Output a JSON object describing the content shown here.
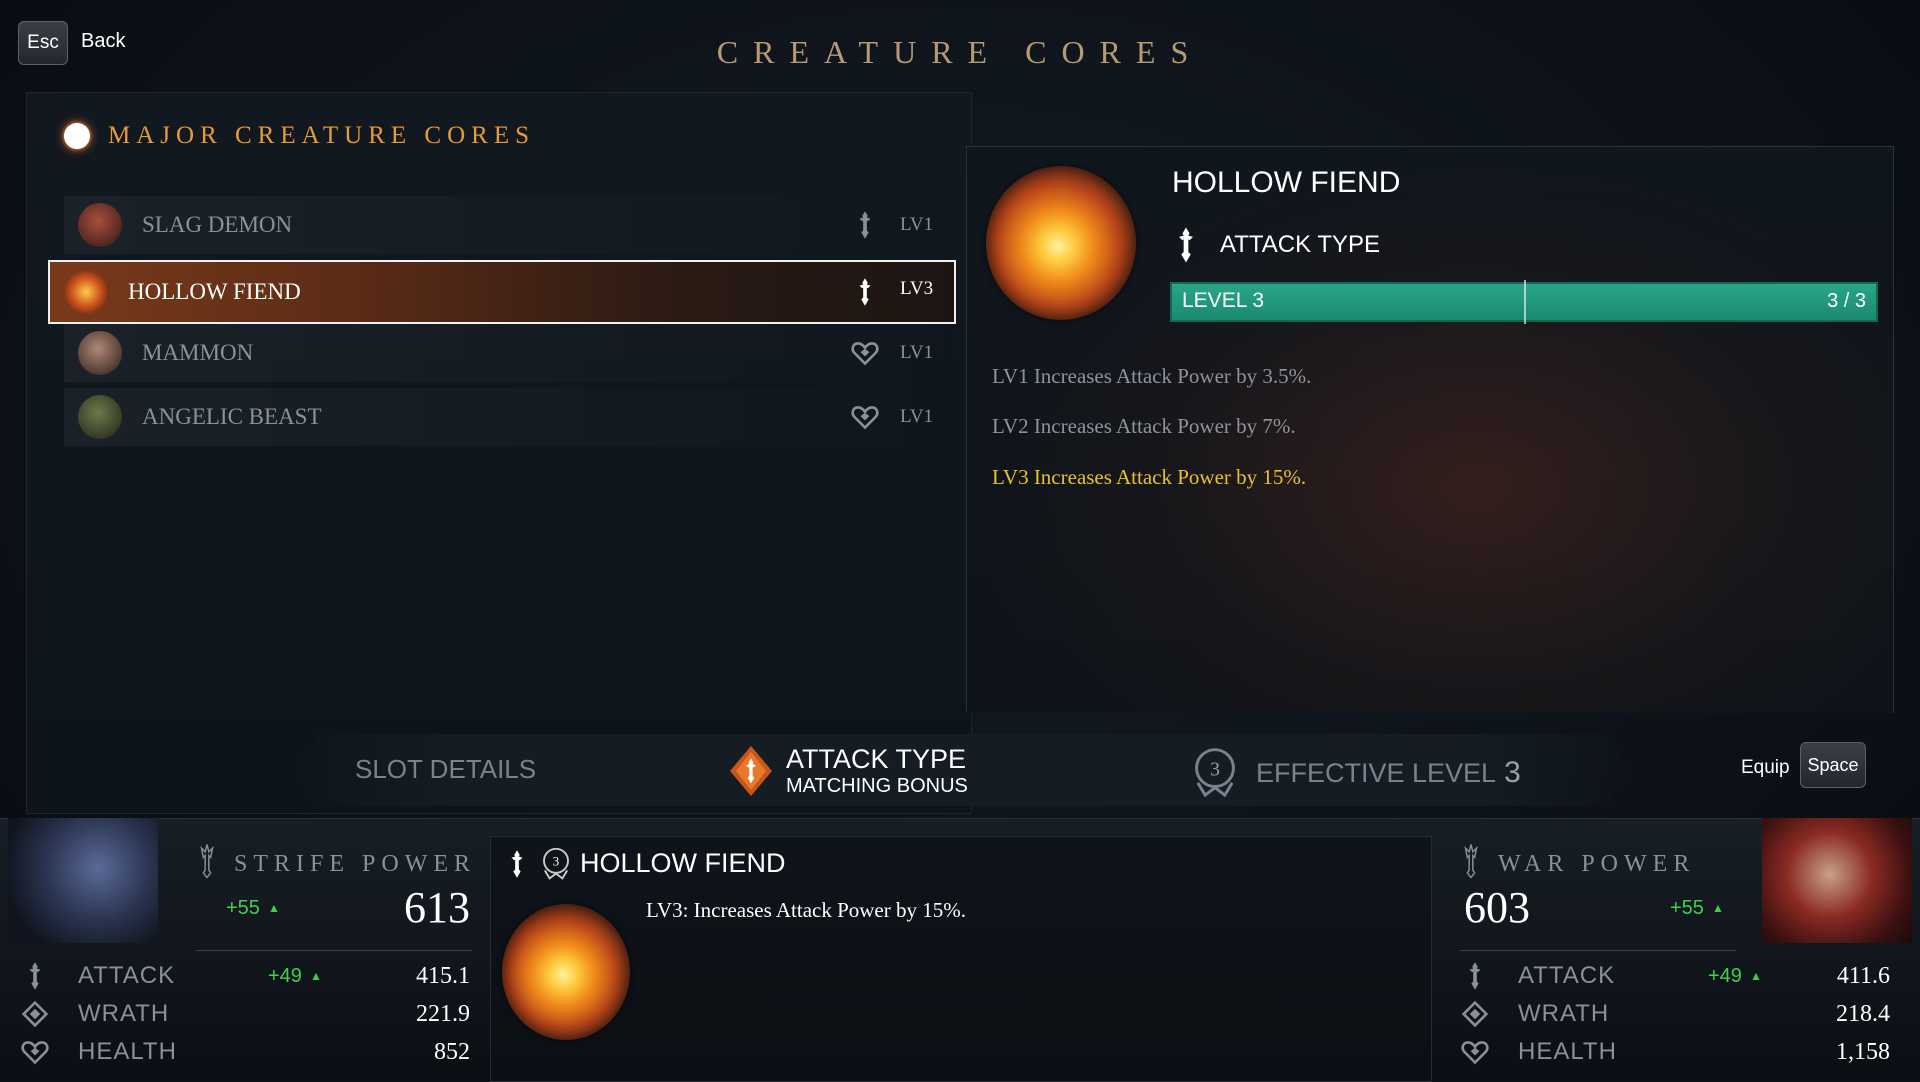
{
  "header": {
    "esc_key": "Esc",
    "back_label": "Back",
    "title": "CREATURE CORES"
  },
  "core_list": {
    "section_title": "MAJOR CREATURE CORES",
    "items": [
      {
        "name": "SLAG DEMON",
        "level": "LV1",
        "type_icon": "attack-type-icon",
        "selected": false
      },
      {
        "name": "HOLLOW FIEND",
        "level": "LV3",
        "type_icon": "attack-type-icon",
        "selected": true
      },
      {
        "name": "MAMMON",
        "level": "LV1",
        "type_icon": "health-type-icon",
        "selected": false
      },
      {
        "name": "ANGELIC BEAST",
        "level": "LV1",
        "type_icon": "health-type-icon",
        "selected": false
      }
    ]
  },
  "detail": {
    "name": "HOLLOW FIEND",
    "type_label": "ATTACK TYPE",
    "level_label": "LEVEL 3",
    "level_fraction": "3 / 3",
    "level_progress": 1.0,
    "effects": [
      {
        "text": "LV1 Increases Attack Power by 3.5%.",
        "active": false
      },
      {
        "text": "LV2 Increases Attack Power by 7%.",
        "active": false
      },
      {
        "text": "LV3 Increases Attack Power by 15%.",
        "active": true
      }
    ]
  },
  "tabs": {
    "slot_details": "SLOT DETAILS",
    "attack_type": "ATTACK TYPE",
    "attack_sub": "MATCHING BONUS",
    "effective_level_label": "EFFECTIVE LEVEL",
    "effective_level_value": "3",
    "effective_badge": "3"
  },
  "equip": {
    "label": "Equip",
    "key": "Space"
  },
  "strife": {
    "title": "STRIFE POWER",
    "power": "613",
    "power_delta": "+55",
    "stats": [
      {
        "label": "ATTACK",
        "value": "415.1",
        "delta": "+49"
      },
      {
        "label": "WRATH",
        "value": "221.9",
        "delta": ""
      },
      {
        "label": "HEALTH",
        "value": "852",
        "delta": ""
      }
    ]
  },
  "war": {
    "title": "WAR POWER",
    "power": "603",
    "power_delta": "+55",
    "stats": [
      {
        "label": "ATTACK",
        "value": "411.6",
        "delta": "+49"
      },
      {
        "label": "WRATH",
        "value": "218.4",
        "delta": ""
      },
      {
        "label": "HEALTH",
        "value": "1,158",
        "delta": ""
      }
    ]
  },
  "equipped_card": {
    "name": "HOLLOW FIEND",
    "level_badge": "3",
    "description": "LV3: Increases Attack Power by 15%."
  },
  "colors": {
    "accent_orange": "#e59a3a",
    "title_gold": "#b69a74",
    "active_effect": "#e7c22e",
    "level_bar": "#1a8a70",
    "positive_delta": "#3fd04a"
  }
}
